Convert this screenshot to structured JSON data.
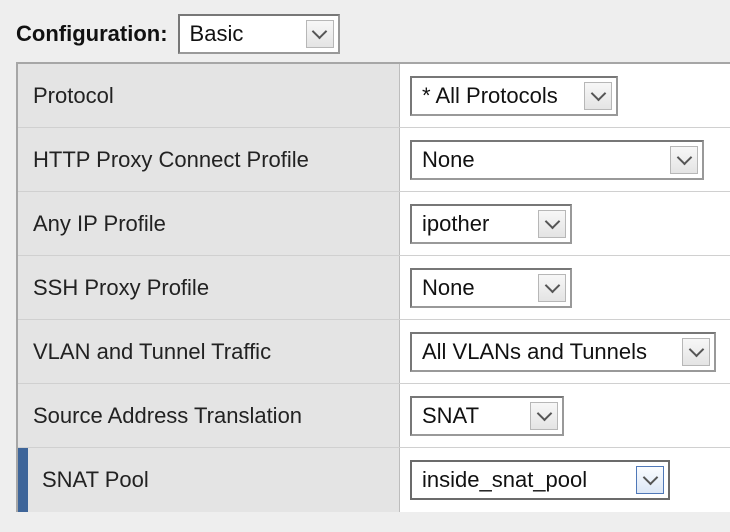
{
  "config": {
    "label": "Configuration:",
    "selected": "Basic"
  },
  "rows": [
    {
      "label": "Protocol",
      "value": "* All Protocols"
    },
    {
      "label": "HTTP Proxy Connect Profile",
      "value": "None"
    },
    {
      "label": "Any IP Profile",
      "value": "ipother"
    },
    {
      "label": "SSH Proxy Profile",
      "value": "None"
    },
    {
      "label": "VLAN and Tunnel Traffic",
      "value": "All VLANs and Tunnels"
    },
    {
      "label": "Source Address Translation",
      "value": "SNAT"
    },
    {
      "label": "SNAT Pool",
      "value": "inside_snat_pool"
    }
  ],
  "colors": {
    "label_bg": "#e4e4e4",
    "marker": "#3e6599",
    "active_arrow_border": "#4f78b8"
  },
  "icons": {
    "dropdown": "chevron-down-icon"
  }
}
